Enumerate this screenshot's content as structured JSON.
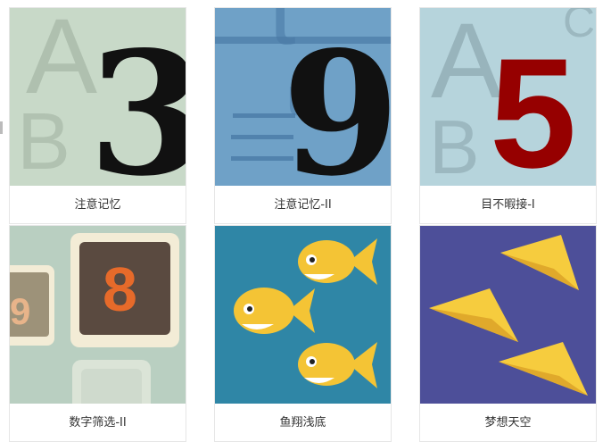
{
  "games": [
    {
      "title": "注意记忆",
      "digit": "3",
      "bg": "#c8d9c8",
      "digit_color": "#111111",
      "ghost_letters": [
        "A",
        "B"
      ]
    },
    {
      "title": "注意记忆-II",
      "digit": "9",
      "bg": "#6fa1c7",
      "digit_color": "#111111",
      "ghost_letters": [
        "t",
        "u"
      ]
    },
    {
      "title": "目不暇接-I",
      "digit": "5",
      "bg": "#b6d4dc",
      "digit_color": "#960000",
      "ghost_letters": [
        "A",
        "B",
        "C"
      ]
    },
    {
      "title": "数字筛选-II",
      "tiles": [
        "9",
        "8"
      ],
      "bg": "#b9cfc1",
      "tile_dark": "#5a4a40",
      "tile_light": "#f3ecd6",
      "digit_color": "#e66a2a"
    },
    {
      "title": "鱼翔浅底",
      "icon": "fish-icon",
      "bg": "#2f86a6",
      "fish_color": "#f4c435"
    },
    {
      "title": "梦想天空",
      "icon": "paper-plane-icon",
      "bg": "#4d4f99",
      "plane_color": "#f6cc3e"
    }
  ]
}
